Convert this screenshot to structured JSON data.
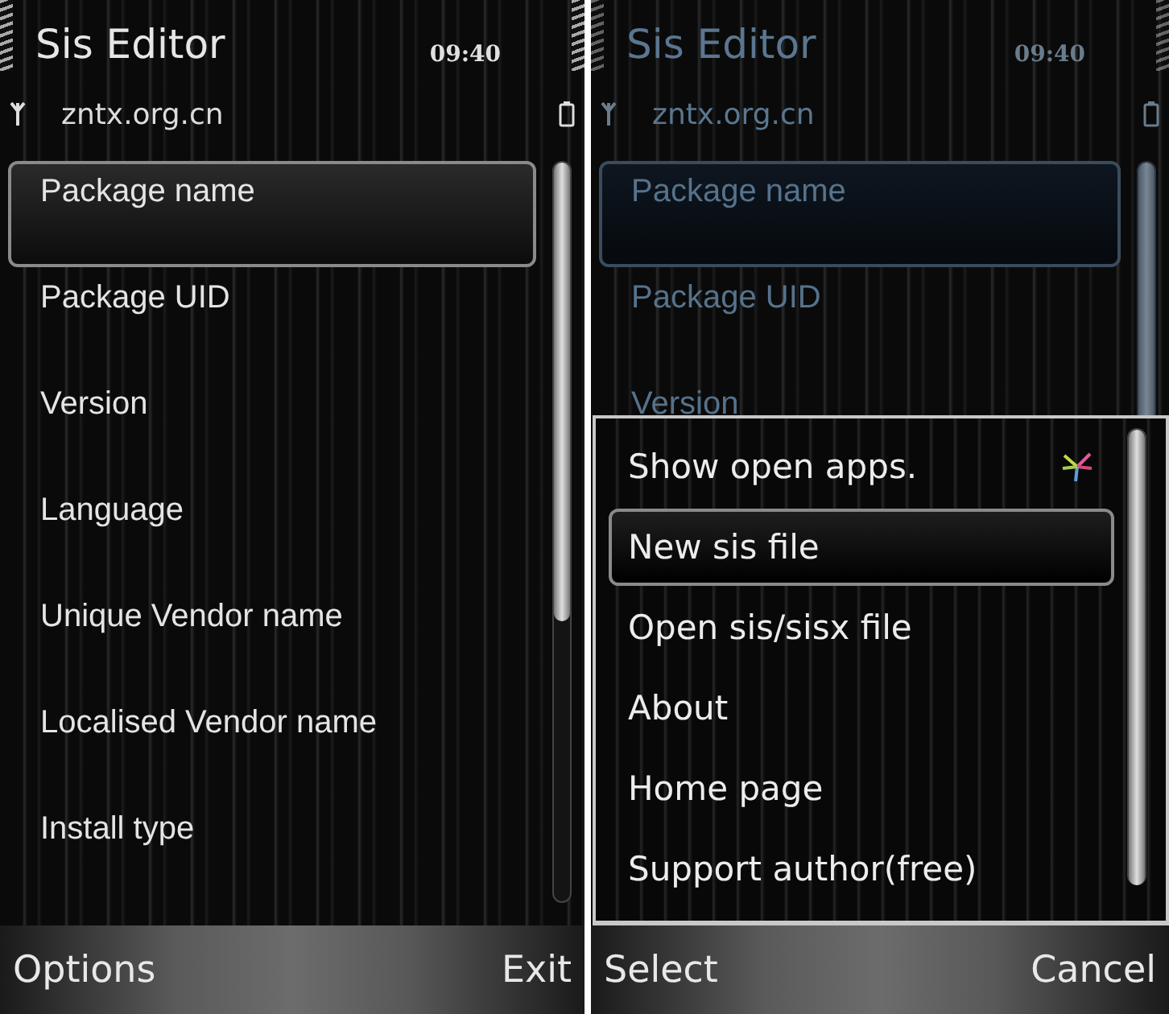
{
  "screens": [
    {
      "dimmed": false,
      "header": {
        "title": "Sis Editor",
        "clock": "09:40",
        "subtitle": "zntx.org.cn"
      },
      "list": [
        {
          "label": "Package name",
          "selected": true
        },
        {
          "label": "Package UID",
          "selected": false
        },
        {
          "label": "Version",
          "selected": false
        },
        {
          "label": "Language",
          "selected": false
        },
        {
          "label": "Unique Vendor name",
          "selected": false
        },
        {
          "label": "Localised Vendor name",
          "selected": false
        },
        {
          "label": "Install type",
          "selected": false
        }
      ],
      "softkeys": {
        "left": "Options",
        "right": "Exit"
      }
    },
    {
      "dimmed": true,
      "header": {
        "title": "Sis Editor",
        "clock": "09:40",
        "subtitle": "zntx.org.cn"
      },
      "list": [
        {
          "label": "Package name",
          "selected": true
        },
        {
          "label": "Package UID",
          "selected": false
        },
        {
          "label": "Version",
          "selected": false
        }
      ],
      "menu": {
        "items": [
          {
            "label": "Show open apps.",
            "selected": false,
            "kind": "apps"
          },
          {
            "label": "New sis file",
            "selected": true,
            "kind": "plain"
          },
          {
            "label": "Open sis/sisx file",
            "selected": false,
            "kind": "plain"
          },
          {
            "label": "About",
            "selected": false,
            "kind": "plain"
          },
          {
            "label": "Home page",
            "selected": false,
            "kind": "plain"
          },
          {
            "label": "Support author(free)",
            "selected": false,
            "kind": "plain"
          }
        ]
      },
      "softkeys": {
        "left": "Select",
        "right": "Cancel"
      }
    }
  ]
}
